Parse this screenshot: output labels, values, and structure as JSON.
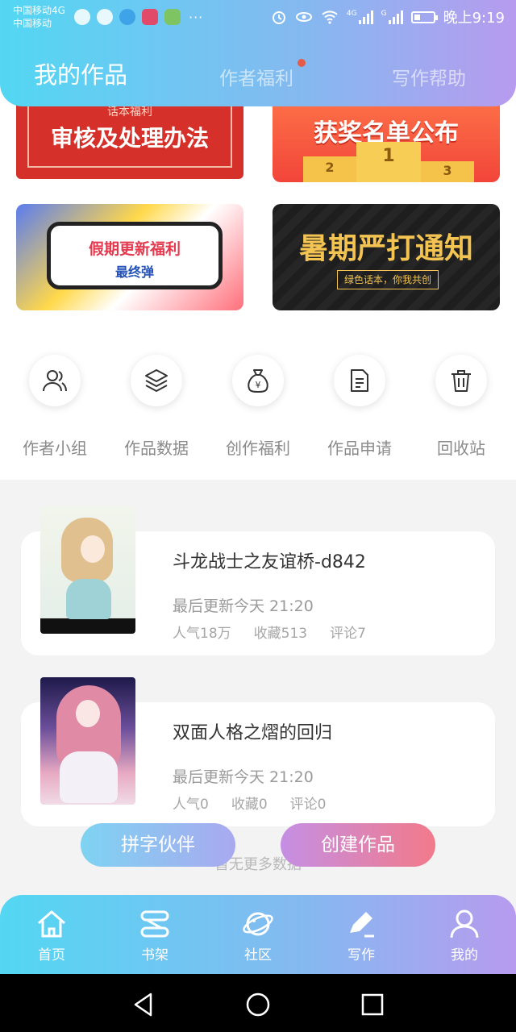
{
  "status_bar": {
    "carrier_1": "中国移动4G",
    "carrier_2": "中国移动",
    "more": "···",
    "network_1": "4G",
    "network_2": "G",
    "time": "晚上9:19"
  },
  "header": {
    "tabs": [
      {
        "label": "我的作品",
        "active": true
      },
      {
        "label": "作者福利",
        "active": false,
        "has_dot": true
      },
      {
        "label": "写作帮助",
        "active": false
      }
    ]
  },
  "banners": [
    {
      "small": "话本福利",
      "title": "审核及处理办法"
    },
    {
      "title": "获奖名单公布",
      "podium": [
        "2",
        "1",
        "3"
      ]
    },
    {
      "title": "假期更新福利",
      "subtitle": "最终弹"
    },
    {
      "title": "暑期严打通知",
      "subtitle": "绿色话本，你我共创"
    }
  ],
  "shortcuts": [
    {
      "label": "作者小组",
      "icon": "users-icon"
    },
    {
      "label": "作品数据",
      "icon": "layers-icon"
    },
    {
      "label": "创作福利",
      "icon": "money-bag-icon"
    },
    {
      "label": "作品申请",
      "icon": "document-icon"
    },
    {
      "label": "回收站",
      "icon": "trash-icon"
    }
  ],
  "works": [
    {
      "title": "斗龙战士之友谊桥-d842",
      "updated": "最后更新今天 21:20",
      "popularity": "人气18万",
      "favorites": "收藏513",
      "comments": "评论7"
    },
    {
      "title": "双面人格之熠的回归",
      "updated": "最后更新今天 21:20",
      "popularity": "人气0",
      "favorites": "收藏0",
      "comments": "评论0"
    }
  ],
  "list_footer": "暂无更多数据",
  "fabs": {
    "partner": "拼字伙伴",
    "create": "创建作品"
  },
  "bottom_nav": [
    {
      "label": "首页",
      "icon": "home-icon"
    },
    {
      "label": "书架",
      "icon": "bookshelf-icon"
    },
    {
      "label": "社区",
      "icon": "planet-icon"
    },
    {
      "label": "写作",
      "icon": "pen-icon"
    },
    {
      "label": "我的",
      "icon": "profile-icon"
    }
  ],
  "colors": {
    "header_gradient_start": "#53d7f3",
    "header_gradient_end": "#b79bee",
    "notification_dot": "#e45b48"
  }
}
